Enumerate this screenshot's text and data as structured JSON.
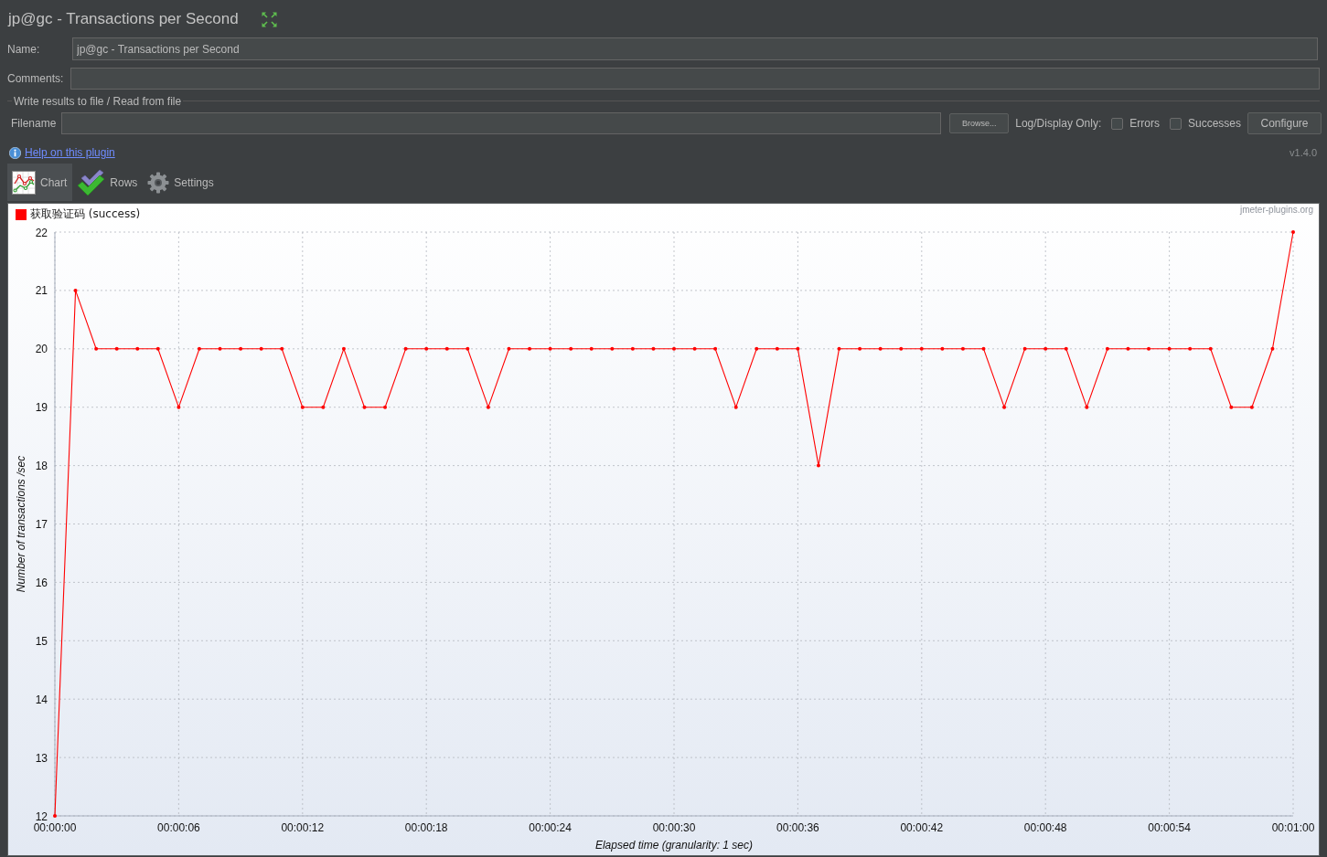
{
  "window": {
    "title": "jp@gc - Transactions per Second"
  },
  "form": {
    "name": {
      "label": "Name:",
      "value": "jp@gc - Transactions per Second"
    },
    "comments": {
      "label": "Comments:"
    }
  },
  "file_section": {
    "title": "Write results to file / Read from file",
    "filename": {
      "label": "Filename"
    },
    "browse_button": "Browse...",
    "log_label": "Log/Display Only:",
    "options": [
      {
        "label": "Errors",
        "checked": false
      },
      {
        "label": "Successes",
        "checked": false
      }
    ],
    "configure_button": "Configure"
  },
  "help_link": "Help on this plugin",
  "version": "v1.4.0",
  "tabs": [
    {
      "label": "Chart",
      "kind": "chart",
      "selected": true
    },
    {
      "label": "Rows",
      "kind": "rows",
      "selected": false
    },
    {
      "label": "Settings",
      "kind": "settings",
      "selected": false
    }
  ],
  "chart": {
    "credit": "jmeter-plugins.org",
    "chart_data": {
      "type": "line",
      "grid": true,
      "xlabel": "Elapsed time (granularity: 1 sec)",
      "ylabel": "Number of transactions /sec",
      "x": [
        0,
        1,
        2,
        3,
        4,
        5,
        6,
        7,
        8,
        9,
        10,
        11,
        12,
        13,
        14,
        15,
        16,
        17,
        18,
        19,
        20,
        21,
        22,
        23,
        24,
        25,
        26,
        27,
        28,
        29,
        30,
        31,
        32,
        33,
        34,
        35,
        36,
        37,
        38,
        39,
        40,
        41,
        42,
        43,
        44,
        45,
        46,
        47,
        48,
        49,
        50,
        51,
        52,
        53,
        54,
        55,
        56,
        57,
        58,
        59,
        60
      ],
      "series": [
        {
          "name": "获取验证码 (success)",
          "color": "#ff0000",
          "values": [
            12,
            21,
            20,
            20,
            20,
            20,
            19,
            20,
            20,
            20,
            20,
            20,
            19,
            19,
            20,
            19,
            19,
            20,
            20,
            20,
            20,
            19,
            20,
            20,
            20,
            20,
            20,
            20,
            20,
            20,
            20,
            20,
            20,
            19,
            20,
            20,
            20,
            18,
            20,
            20,
            20,
            20,
            20,
            20,
            20,
            20,
            19,
            20,
            20,
            20,
            19,
            20,
            20,
            20,
            20,
            20,
            20,
            19,
            19,
            20,
            22
          ]
        }
      ],
      "xlim": [
        0,
        60
      ],
      "ylim": [
        12,
        22
      ],
      "xticks": [
        {
          "value": 0,
          "label": "00:00:00"
        },
        {
          "value": 6,
          "label": "00:00:06"
        },
        {
          "value": 12,
          "label": "00:00:12"
        },
        {
          "value": 18,
          "label": "00:00:18"
        },
        {
          "value": 24,
          "label": "00:00:24"
        },
        {
          "value": 30,
          "label": "00:00:30"
        },
        {
          "value": 36,
          "label": "00:00:36"
        },
        {
          "value": 42,
          "label": "00:00:42"
        },
        {
          "value": 48,
          "label": "00:00:48"
        },
        {
          "value": 54,
          "label": "00:00:54"
        },
        {
          "value": 60,
          "label": "00:01:00"
        }
      ],
      "yticks": [
        12,
        13,
        14,
        15,
        16,
        17,
        18,
        19,
        20,
        21,
        22
      ]
    }
  }
}
